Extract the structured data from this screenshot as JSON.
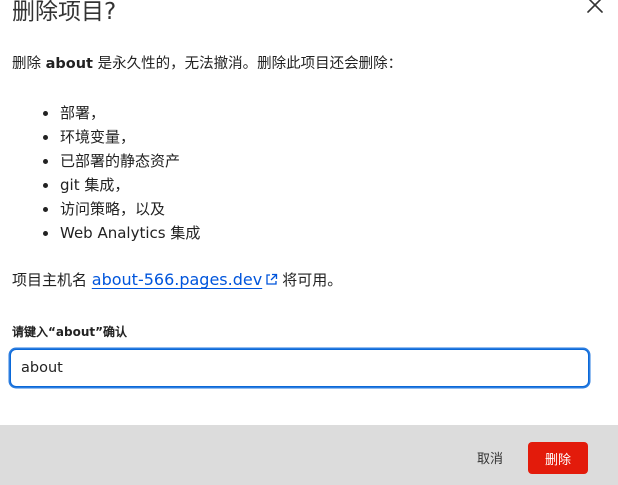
{
  "dialog": {
    "title": "删除项目?",
    "close_icon": "close-icon"
  },
  "description": {
    "prefix": "删除 ",
    "project_name": "about",
    "suffix": " 是永久性的，无法撤消。删除此项目还会删除："
  },
  "deleted_items": [
    "部署，",
    "环境变量，",
    "已部署的静态资产",
    "git 集成，",
    "访问策略，以及",
    "Web Analytics 集成"
  ],
  "hostname_note": {
    "prefix": "项目主机名 ",
    "hostname": "about-566.pages.dev",
    "link_icon": "external-link-icon",
    "suffix": "将可用。"
  },
  "confirm": {
    "label": "请键入“about”确认",
    "value": "about"
  },
  "footer": {
    "cancel_label": "取消",
    "delete_label": "删除"
  },
  "colors": {
    "link": "#0055dc",
    "danger": "#e31b0b",
    "focus_border": "#0a68d8",
    "footer_bg": "#dcdcdc"
  }
}
